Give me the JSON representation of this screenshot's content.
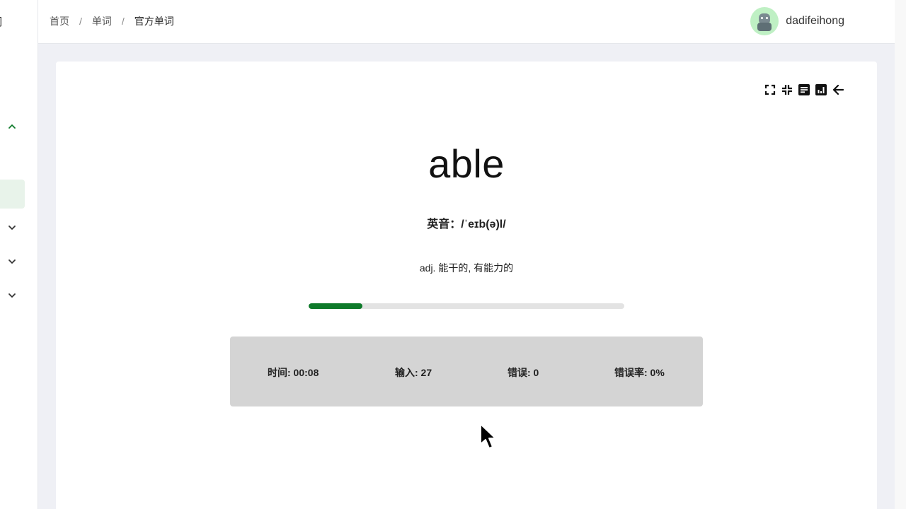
{
  "sidebar": {
    "clipped_title": "词",
    "chevrons": [
      "chevron-up-icon",
      "chevron-down-icon",
      "chevron-down-icon",
      "chevron-down-icon"
    ],
    "accent_color": "#0e7a2a"
  },
  "header": {
    "breadcrumb": [
      "首页",
      "单词",
      "官方单词"
    ],
    "separator": "/",
    "username": "dadifeihong"
  },
  "toolbar": {
    "icons": [
      "fullscreen-icon",
      "exit-fullscreen-icon",
      "document-icon",
      "chart-icon",
      "back-arrow-icon"
    ]
  },
  "word": {
    "text": "able",
    "phonetic": "英音：/ˈeɪb(ə)l/",
    "meaning": "adj. 能干的, 有能力的"
  },
  "progress": {
    "fraction": 0.17,
    "color": "#0e7a2a"
  },
  "stats": {
    "time": "时间: 00:08",
    "input": "输入: 27",
    "errors": "错误: 0",
    "error_rate": "错误率: 0%"
  }
}
